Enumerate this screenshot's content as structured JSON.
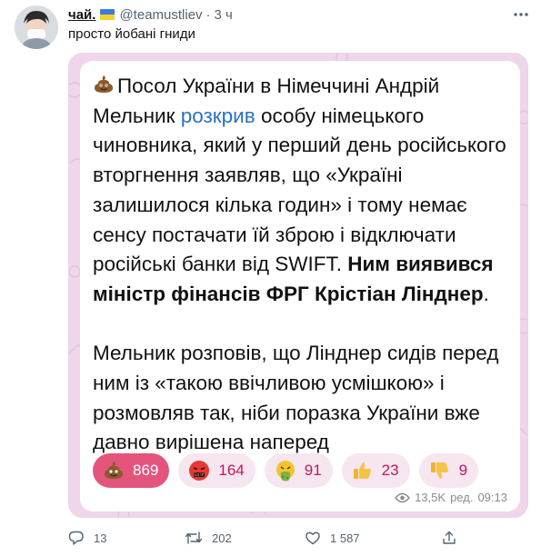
{
  "author": {
    "name": "чай.",
    "flag_icon": "ukraine-flag-icon",
    "handle": "@teamustliev",
    "separator": "·",
    "time": "3 ч",
    "avatar_icon": "user-avatar"
  },
  "tweet": {
    "text": "просто йобані гниди",
    "more_icon": "more-options-icon"
  },
  "media": {
    "message": {
      "p1_emoji": "pile-of-poo-emoji",
      "p1_a": "Посол України в Німеччині Андрій Мельник ",
      "p1_link": "розкрив",
      "p1_b": " особу німецького чиновника, який у перший день російського вторгнення заявляв, що «Україні залишилося кілька годин» і тому немає сенсу постачати їй зброю і відключати російські банки від SWIFT. ",
      "p1_bold": "Ним виявився міністр фінансів ФРГ Крістіан Лінднер",
      "p1_end": ".",
      "p2": "Мельник розповів, що Лінднер сидів перед ним із «такою ввічливою усмішкою» і розмовляв так, ніби поразка України вже давно вирішена наперед"
    },
    "reactions": [
      {
        "icon": "pile-of-poo-emoji",
        "count": "869",
        "active": true
      },
      {
        "icon": "cursing-face-emoji",
        "count": "164",
        "active": false
      },
      {
        "icon": "vomiting-face-emoji",
        "count": "91",
        "active": false
      },
      {
        "icon": "thumbs-up-emoji",
        "count": "23",
        "active": false
      },
      {
        "icon": "thumbs-down-emoji",
        "count": "9",
        "active": false
      }
    ],
    "views_icon": "eye-icon",
    "views": "13,5K",
    "edited": "ред.",
    "post_time": "09:13",
    "colors": {
      "reaction_active": "#e4557e",
      "reaction_text": "#c2185b",
      "link": "#2a72c4",
      "background": "#efd6ea"
    }
  },
  "actions": {
    "reply_count": "13",
    "retweet_count": "202",
    "like_count": "1 587"
  }
}
